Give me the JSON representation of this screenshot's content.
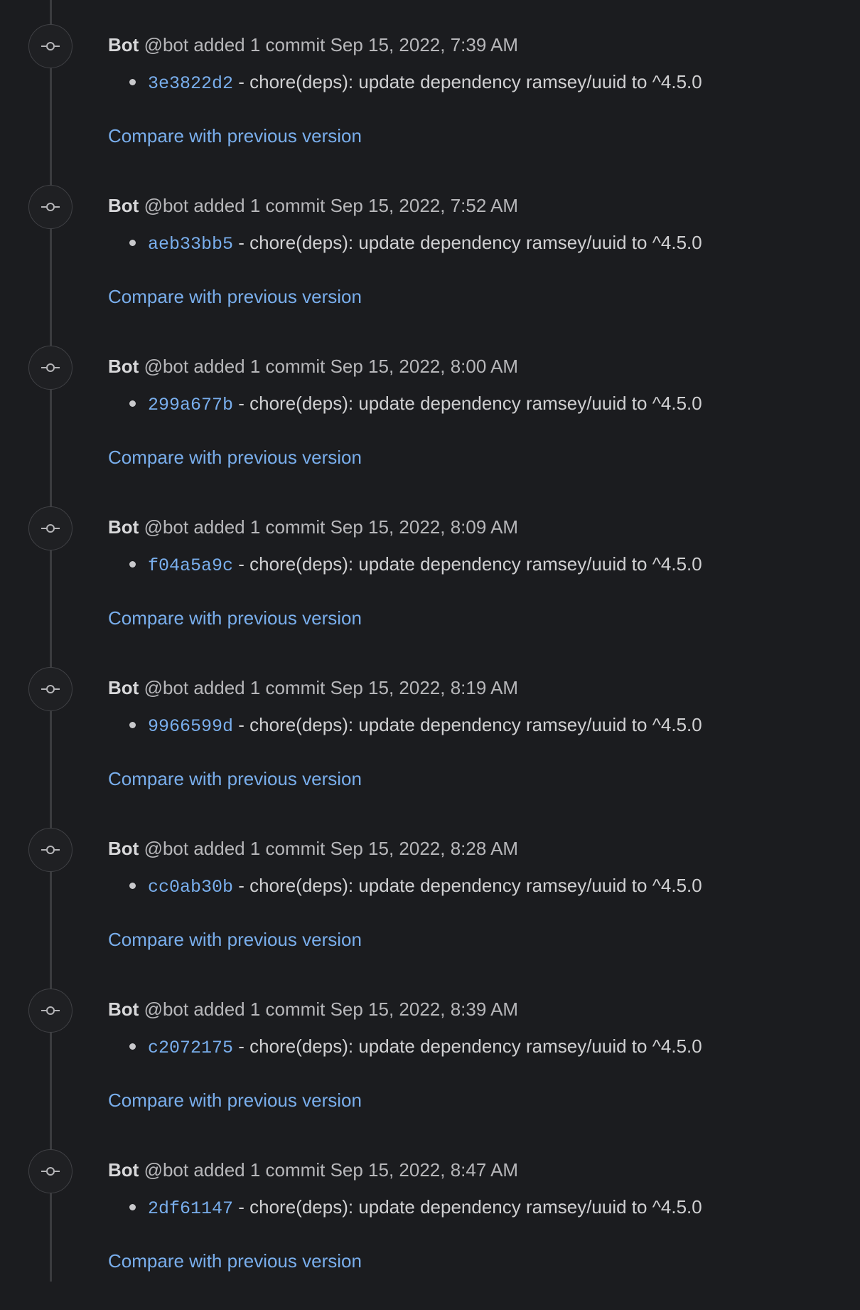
{
  "timeline": {
    "items": [
      {
        "author": "Bot",
        "handle": "@bot",
        "action": "added 1 commit",
        "timestamp": "Sep 15, 2022, 7:39 AM",
        "sha": "3e3822d2",
        "message": " - chore(deps): update dependency ramsey/uuid to ^4.5.0",
        "compare_label": "Compare with previous version"
      },
      {
        "author": "Bot",
        "handle": "@bot",
        "action": "added 1 commit",
        "timestamp": "Sep 15, 2022, 7:52 AM",
        "sha": "aeb33bb5",
        "message": " - chore(deps): update dependency ramsey/uuid to ^4.5.0",
        "compare_label": "Compare with previous version"
      },
      {
        "author": "Bot",
        "handle": "@bot",
        "action": "added 1 commit",
        "timestamp": "Sep 15, 2022, 8:00 AM",
        "sha": "299a677b",
        "message": " - chore(deps): update dependency ramsey/uuid to ^4.5.0",
        "compare_label": "Compare with previous version"
      },
      {
        "author": "Bot",
        "handle": "@bot",
        "action": "added 1 commit",
        "timestamp": "Sep 15, 2022, 8:09 AM",
        "sha": "f04a5a9c",
        "message": " - chore(deps): update dependency ramsey/uuid to ^4.5.0",
        "compare_label": "Compare with previous version"
      },
      {
        "author": "Bot",
        "handle": "@bot",
        "action": "added 1 commit",
        "timestamp": "Sep 15, 2022, 8:19 AM",
        "sha": "9966599d",
        "message": " - chore(deps): update dependency ramsey/uuid to ^4.5.0",
        "compare_label": "Compare with previous version"
      },
      {
        "author": "Bot",
        "handle": "@bot",
        "action": "added 1 commit",
        "timestamp": "Sep 15, 2022, 8:28 AM",
        "sha": "cc0ab30b",
        "message": " - chore(deps): update dependency ramsey/uuid to ^4.5.0",
        "compare_label": "Compare with previous version"
      },
      {
        "author": "Bot",
        "handle": "@bot",
        "action": "added 1 commit",
        "timestamp": "Sep 15, 2022, 8:39 AM",
        "sha": "c2072175",
        "message": " - chore(deps): update dependency ramsey/uuid to ^4.5.0",
        "compare_label": "Compare with previous version"
      },
      {
        "author": "Bot",
        "handle": "@bot",
        "action": "added 1 commit",
        "timestamp": "Sep 15, 2022, 8:47 AM",
        "sha": "2df61147",
        "message": " - chore(deps): update dependency ramsey/uuid to ^4.5.0",
        "compare_label": "Compare with previous version"
      }
    ]
  },
  "theme": {
    "background": "#1b1c1f",
    "link": "#79aeec",
    "text": "#d0d0d2",
    "muted": "#b7b7ba",
    "timeline_line": "#3a3b3e"
  },
  "icons": {
    "timeline_badge": "commit-icon"
  }
}
